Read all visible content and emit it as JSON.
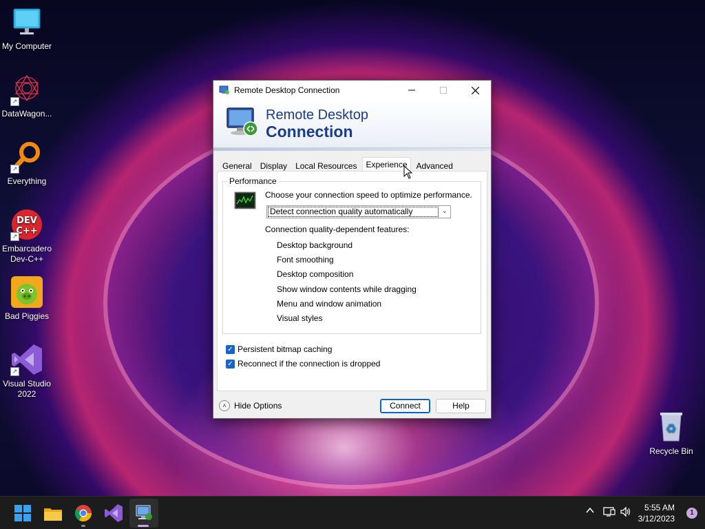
{
  "desktop": {
    "icons": [
      {
        "label": "My Computer",
        "icon": "monitor-icon"
      },
      {
        "label": "DataWagon...",
        "icon": "datawagon-icon"
      },
      {
        "label": "Everything",
        "icon": "everything-search-icon"
      },
      {
        "label": "Embarcadero Dev-C++",
        "icon": "devcpp-icon"
      },
      {
        "label": "Bad Piggies",
        "icon": "bad-piggies-icon"
      },
      {
        "label": "Visual Studio 2022",
        "icon": "visual-studio-icon"
      },
      {
        "label": "Recycle Bin",
        "icon": "recycle-bin-icon"
      }
    ]
  },
  "dialog": {
    "title": "Remote Desktop Connection",
    "banner_line1": "Remote Desktop",
    "banner_line2": "Connection",
    "tabs": [
      {
        "label": "General"
      },
      {
        "label": "Display"
      },
      {
        "label": "Local Resources"
      },
      {
        "label": "Experience",
        "active": true
      },
      {
        "label": "Advanced"
      }
    ],
    "performance": {
      "group_title": "Performance",
      "choose_label": "Choose your connection speed to optimize performance.",
      "speed_selected": "Detect connection quality automatically",
      "features_label": "Connection quality-dependent features:",
      "features": [
        "Desktop background",
        "Font smoothing",
        "Desktop composition",
        "Show window contents while dragging",
        "Menu and window animation",
        "Visual styles"
      ]
    },
    "checkboxes": [
      {
        "label": "Persistent bitmap caching",
        "checked": true
      },
      {
        "label": "Reconnect if the connection is dropped",
        "checked": true
      }
    ],
    "hide_options_label": "Hide Options",
    "connect_label": "Connect",
    "help_label": "Help"
  },
  "taskbar": {
    "pinned": [
      {
        "icon": "windows-start-icon"
      },
      {
        "icon": "file-explorer-icon"
      },
      {
        "icon": "chrome-icon"
      },
      {
        "icon": "visual-studio-icon"
      },
      {
        "icon": "remote-desktop-icon",
        "active": true
      }
    ],
    "time": "5:55 AM",
    "date": "3/12/2023",
    "notification_count": "1"
  },
  "colors": {
    "accent": "#0a64c8",
    "banner_text": "#1a3c8a",
    "taskbar": "#1c1c1c"
  }
}
